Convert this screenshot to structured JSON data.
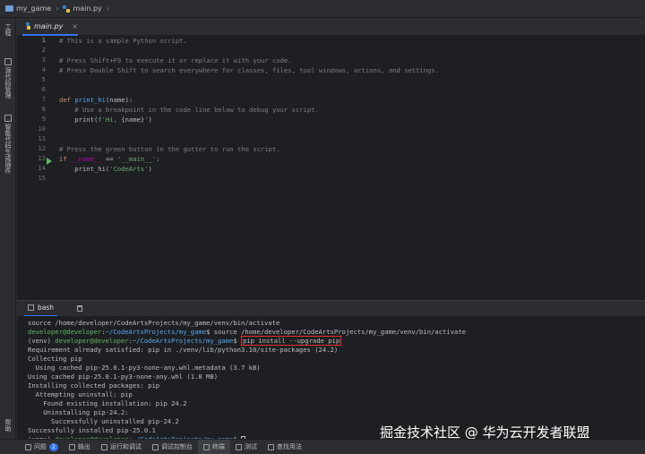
{
  "breadcrumb": {
    "project": "my_game",
    "file": "main.py"
  },
  "tab": {
    "label": "main.py",
    "close": "×"
  },
  "sidebar": {
    "items": [
      {
        "label": "工程"
      },
      {
        "label": "源代码管理"
      },
      {
        "label": "智能代码生成插件"
      },
      {
        "label": "帮助"
      }
    ]
  },
  "editor": {
    "line_numbers": [
      "1",
      "2",
      "3",
      "4",
      "5",
      "6",
      "7",
      "8",
      "9",
      "10",
      "11",
      "12",
      "13",
      "14",
      "15"
    ],
    "lines": [
      "# This is a sample Python script.",
      "",
      "# Press Shift+F9 to execute it or replace it with your code.",
      "# Press Double Shift to search everywhere for classes, files, tool windows, actions, and settings.",
      "",
      "",
      "def print_hi(name):",
      "    # Use a breakpoint in the code line below to debug your script.",
      "    print(f'Hi, {name}')",
      "",
      "",
      "# Press the green button in the gutter to run the script.",
      "if __name__ == '__main__':",
      "    print_hi('CodeArts')",
      ""
    ]
  },
  "terminal": {
    "tab_label": "bash",
    "lines": [
      "source /home/developer/CodeArtsProjects/my_game/venv/bin/activate",
      "developer@developer:~/CodeArtsProjects/my_game$ source /home/developer/CodeArtsProjects/my_game/venv/bin/activate",
      "(venv) developer@developer:~/CodeArtsProjects/my_game$ pip install --upgrade pip",
      "Requirement already satisfied: pip in ./venv/lib/python3.10/site-packages (24.2)",
      "Collecting pip",
      "  Using cached pip-25.0.1-py3-none-any.whl.metadata (3.7 kB)",
      "Using cached pip-25.0.1-py3-none-any.whl (1.8 MB)",
      "Installing collected packages: pip",
      "  Attempting uninstall: pip",
      "    Found existing installation: pip 24.2",
      "    Uninstalling pip-24.2:",
      "      Successfully uninstalled pip-24.2",
      "Successfully installed pip-25.0.1",
      "(venv) developer@developer:~/CodeArtsProjects/my_game$ "
    ],
    "user_host": "developer@developer",
    "path": "~/CodeArtsProjects/my_game",
    "venv": "(venv) ",
    "prompt_end": "$ ",
    "cmd_source": "source /home/developer/CodeArtsProjects/my_game/venv/bin/activate",
    "cmd_pip": "pip install --upgrade pip"
  },
  "watermark": "掘金技术社区 @ 华为云开发者联盟",
  "bottom_bar": {
    "items": [
      {
        "label": "问题",
        "badge": "2"
      },
      {
        "label": "输出"
      },
      {
        "label": "运行和调试"
      },
      {
        "label": "调试控制台"
      },
      {
        "label": "终端"
      },
      {
        "label": "测试"
      },
      {
        "label": "查找用法"
      }
    ],
    "active_index": 4
  },
  "colors": {
    "accent": "#3574f0",
    "highlight_box": "#e5302a",
    "run_arrow": "#5fb865"
  }
}
